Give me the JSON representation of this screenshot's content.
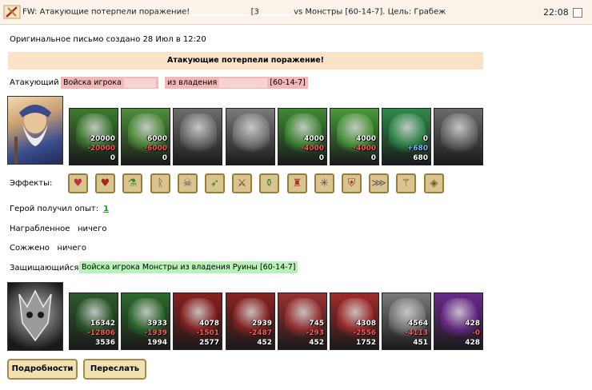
{
  "title_bar": {
    "subject_prefix": "FW: Атакующие потерпели поражение! ",
    "subject_mid": " [3",
    "subject_suffix": " vs Монстры [60-14-7]. Цель: Грабеж",
    "time": "22:08"
  },
  "original_note": "Оригинальное письмо создано 28 Июл в 12:20",
  "result_banner": "Атакующие потерпели поражение!",
  "attacker": {
    "label": "Атакующий",
    "army_prefix": "Войска игрока",
    "army_mid": "из владения",
    "army_suffix": "[60-14-7]",
    "units": [
      {
        "name": "dwarf",
        "values": [
          "20000",
          "-20000",
          "0"
        ],
        "color": "#3b7a2e"
      },
      {
        "name": "knight",
        "values": [
          "6000",
          "-6000",
          "0"
        ],
        "color": "#4f8f3a"
      },
      {
        "name": "paladin",
        "values": [
          "",
          "",
          ""
        ],
        "color": "#6d6d6d"
      },
      {
        "name": "griffin",
        "values": [
          "",
          "",
          ""
        ],
        "color": "#7a7a7a"
      },
      {
        "name": "archer",
        "values": [
          "4000",
          "-4000",
          "0"
        ],
        "color": "#3e8a33"
      },
      {
        "name": "ranger",
        "values": [
          "4000",
          "-4000",
          "0"
        ],
        "color": "#4a9a3a"
      },
      {
        "name": "druid",
        "values": [
          "0",
          "+680",
          "680"
        ],
        "color": "#2f8a4a"
      },
      {
        "name": "ghost",
        "values": [
          "",
          "",
          ""
        ],
        "color": "#6a6a6a"
      }
    ]
  },
  "effects_label": "Эффекты:",
  "effects": [
    {
      "icon": "heart-icon",
      "glyph": "♥",
      "color": "#c0303a"
    },
    {
      "icon": "heart-arrow-icon",
      "glyph": "♥",
      "color": "#b02020"
    },
    {
      "icon": "potion-icon",
      "glyph": "⚗",
      "color": "#3a8a2a"
    },
    {
      "icon": "rune-icon",
      "glyph": "ᚱ",
      "color": "#7a4a1a"
    },
    {
      "icon": "skull-icon",
      "glyph": "☠",
      "color": "#5a5a5a"
    },
    {
      "icon": "bow-icon",
      "glyph": "➶",
      "color": "#3a7a2a"
    },
    {
      "icon": "sword-icon",
      "glyph": "⚔",
      "color": "#8a2020"
    },
    {
      "icon": "flask-icon",
      "glyph": "⚱",
      "color": "#3a8a3a"
    },
    {
      "icon": "tower-icon",
      "glyph": "♜",
      "color": "#b03030"
    },
    {
      "icon": "web-icon",
      "glyph": "✳",
      "color": "#4a4a6a"
    },
    {
      "icon": "shield-icon",
      "glyph": "⛨",
      "color": "#b02a2a"
    },
    {
      "icon": "comb-icon",
      "glyph": "⋙",
      "color": "#5a5a5a"
    },
    {
      "icon": "wand-icon",
      "glyph": "⚚",
      "color": "#6a3a1a"
    },
    {
      "icon": "target-icon",
      "glyph": "◈",
      "color": "#7a5a2a"
    }
  ],
  "experience": {
    "label": "Герой получил опыт:",
    "value": "1"
  },
  "reward": {
    "label": "Награбленное",
    "value": "ничего"
  },
  "burned": {
    "label": "Сожжено",
    "value": "ничего"
  },
  "defender": {
    "label": "Защищающийся",
    "army": "Войска игрока Монстры из владения Руины [60-14-7]",
    "units": [
      {
        "name": "demon-spider",
        "values": [
          "16342",
          "-12806",
          "3536"
        ],
        "color": "#2c5a2c"
      },
      {
        "name": "ogre",
        "values": [
          "3933",
          "-1939",
          "1994"
        ],
        "color": "#2c6a2c"
      },
      {
        "name": "orc-warrior",
        "values": [
          "4078",
          "-1501",
          "2577"
        ],
        "color": "#8a2020"
      },
      {
        "name": "gargoyle",
        "values": [
          "2939",
          "-2487",
          "452"
        ],
        "color": "#8a2222"
      },
      {
        "name": "claw-beast",
        "values": [
          "745",
          "-293",
          "452"
        ],
        "color": "#9a3030"
      },
      {
        "name": "devil",
        "values": [
          "4308",
          "-2556",
          "1752"
        ],
        "color": "#a02a2a"
      },
      {
        "name": "golem",
        "values": [
          "4564",
          "-4113",
          "451"
        ],
        "color": "#7a7a7a"
      },
      {
        "name": "imp",
        "values": [
          "428",
          "-0",
          "428"
        ],
        "color": "#6a2a8a"
      }
    ]
  },
  "buttons": {
    "details": "Подробности",
    "forward": "Переслать"
  }
}
